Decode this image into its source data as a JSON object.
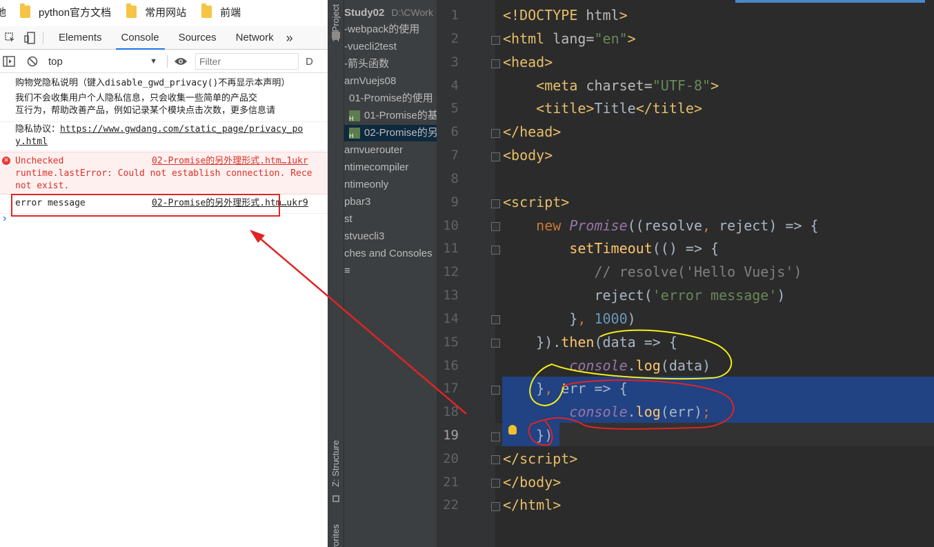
{
  "bookmarks": {
    "cut_item": "地",
    "items": [
      {
        "label": "python官方文档"
      },
      {
        "label": "常用网站"
      },
      {
        "label": "前端"
      }
    ]
  },
  "devtools": {
    "tabs": [
      "Elements",
      "Console",
      "Sources",
      "Network"
    ],
    "active_tab": "Console",
    "more_tabs": "»",
    "context": "top",
    "filter_placeholder": "Filter",
    "cut_label": "D"
  },
  "console": {
    "privacy_title": "购物党隐私说明（键入disable_gwd_privacy()不再显示本声明）",
    "privacy_body_1": "    我们不会收集用户个人隐私信息，只会收集一些简单的产品交",
    "privacy_body_2": "互行为，帮助改善产品，例如记录某个模块点击次数，更多信息请",
    "agreement_label": "隐私协议：",
    "agreement_link_1": "https://www.gwdang.com/static_page/privacy_po",
    "agreement_link_2": "y.html",
    "error_line_1": "Unchecked",
    "error_source": "02-Promise的另外理形式.htm…1ukr",
    "error_line_2": "runtime.lastError: Could not establish connection. Rece",
    "error_line_3": "not exist.",
    "message": "error message",
    "message_source": "02-Promise的另外理形式.htm…ukr9",
    "prompt": "›"
  },
  "sidebar_labels": {
    "project": "1: Project",
    "structure": "Z: Structure",
    "favorites": "Favorites"
  },
  "project_tree": [
    {
      "label": "Study02",
      "suffix": "D:\\CWork"
    },
    {
      "label": "-webpack的使用"
    },
    {
      "label": "-vuecli2test"
    },
    {
      "label": "-箭头函数"
    },
    {
      "label": "arnVuejs08"
    },
    {
      "label": "01-Promise的使用"
    },
    {
      "label": "01-Promise的基"
    },
    {
      "label": "02-Promise的另"
    },
    {
      "label": "arnvuerouter"
    },
    {
      "label": "ntimecompiler"
    },
    {
      "label": "ntimeonly"
    },
    {
      "label": "pbar3"
    },
    {
      "label": "st"
    },
    {
      "label": "stvuecli3"
    },
    {
      "label": "ches and Consoles"
    },
    {
      "label": "≡"
    }
  ],
  "editor": {
    "line_numbers": [
      "1",
      "2",
      "3",
      "4",
      "5",
      "6",
      "7",
      "8",
      "9",
      "10",
      "11",
      "12",
      "13",
      "14",
      "15",
      "16",
      "17",
      "18",
      "19",
      "20",
      "21",
      "22"
    ],
    "highlighted_lines": [
      17,
      18
    ],
    "current_line": 19
  },
  "colors": {
    "annotation_red": "#e02424",
    "annotation_yellow": "#f5ee1a",
    "selection_blue": "#214283"
  }
}
